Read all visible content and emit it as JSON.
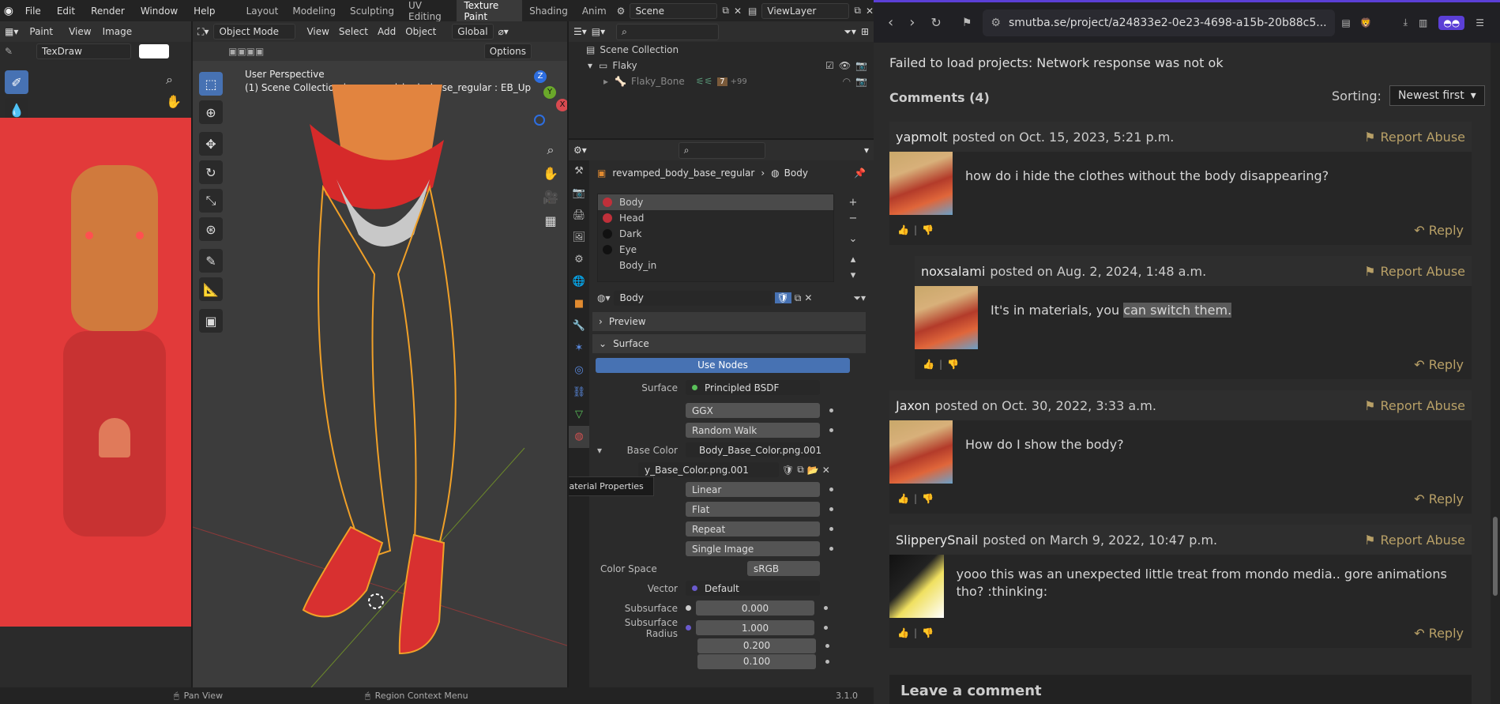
{
  "blender": {
    "menu": [
      "File",
      "Edit",
      "Render",
      "Window",
      "Help"
    ],
    "workspaces": [
      "Layout",
      "Modeling",
      "Sculpting",
      "UV Editing",
      "Texture Paint",
      "Shading",
      "Anim"
    ],
    "active_workspace": "Texture Paint",
    "scene": "Scene",
    "view_layer": "ViewLayer",
    "image_editor": {
      "mode": "Paint",
      "menu": [
        "View",
        "Image"
      ],
      "brush": "TexDraw"
    },
    "viewport": {
      "mode": "Object Mode",
      "menu": [
        "View",
        "Select",
        "Add",
        "Object"
      ],
      "orientation": "Global",
      "options": "Options",
      "overlay_title": "User Perspective",
      "overlay_sub": "(1) Scene Collection | revamped_body_base_regular : EB_Up"
    },
    "outliner": {
      "rows": [
        {
          "label": "Scene Collection",
          "indent": 0
        },
        {
          "label": "Flaky",
          "indent": 1
        },
        {
          "label": "Flaky_Bone",
          "indent": 2,
          "extra": "+99",
          "badge": "7"
        }
      ]
    },
    "properties": {
      "breadcrumb_object": "revamped_body_base_regular",
      "breadcrumb_material": "Body",
      "slots": [
        "Body",
        "Head",
        "Dark",
        "Eye",
        "Body_in"
      ],
      "slot_colors": [
        "#c0303a",
        "#c0303a",
        "#111111",
        "#111111",
        "transparent"
      ],
      "material_name": "Body",
      "preview": "Preview",
      "surface_panel": "Surface",
      "use_nodes": "Use Nodes",
      "surface_label": "Surface",
      "surface_value": "Principled BSDF",
      "distribution": "GGX",
      "subsurface_method": "Random Walk",
      "base_color_label": "Base Color",
      "base_color_value": "Body_Base_Color.png.001",
      "image_name": "y_Base_Color.png.001",
      "interpolation": "Linear",
      "projection": "Flat",
      "extension": "Repeat",
      "source": "Single Image",
      "color_space_label": "Color Space",
      "color_space": "sRGB",
      "vector_label": "Vector",
      "vector_value": "Default",
      "subsurface_label": "Subsurface",
      "subsurface_value": "0.000",
      "subsurface_radius_label": "Subsurface Radius",
      "subsurface_radius": [
        "1.000",
        "0.200",
        "0.100"
      ],
      "tooltip": "Material Properties"
    },
    "status": {
      "left": "Pan View",
      "middle": "Region Context Menu",
      "version": "3.1.0"
    }
  },
  "browser": {
    "url": "smutba.se/project/a24833e2-0e23-4698-a15b-20b88c5...",
    "error": "Failed to load projects: Network response was not ok",
    "comments_title": "Comments (4)",
    "sorting_label": "Sorting:",
    "sorting_value": "Newest first",
    "report_label": "Report Abuse",
    "reply_label": "Reply",
    "leave_comment": "Leave a comment",
    "comments": [
      {
        "user": "yapmolt",
        "meta": "posted on Oct. 15, 2023, 5:21 p.m.",
        "text": "how do i hide the clothes without the body disappearing?",
        "reply": false
      },
      {
        "user": "noxsalami",
        "meta": "posted on Aug. 2, 2024, 1:48 a.m.",
        "text_a": "It's in materials, you ",
        "text_b": "can switch them.",
        "reply": true
      },
      {
        "user": "Jaxon",
        "meta": "posted on Oct. 30, 2022, 3:33 a.m.",
        "text": "How do I show the body?",
        "reply": false
      },
      {
        "user": "SlipperySnail",
        "meta": "posted on March 9, 2022, 10:47 p.m.",
        "text": "yooo this was an unexpected little treat from mondo media.. gore animations tho? :thinking:",
        "reply": false
      }
    ]
  }
}
